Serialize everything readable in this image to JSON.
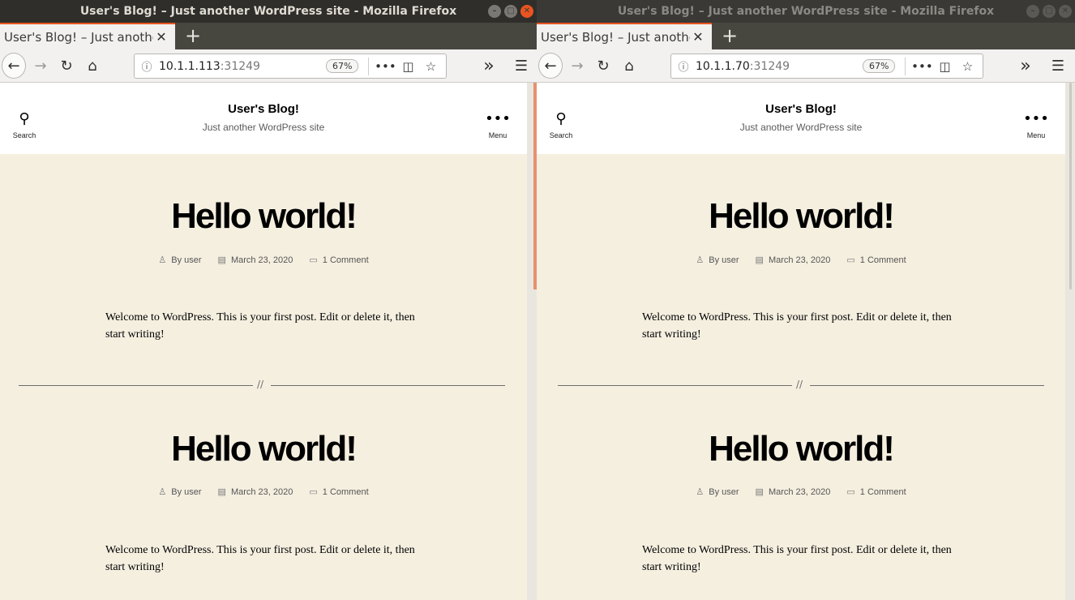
{
  "windows": [
    {
      "window_title": "User's Blog! – Just another WordPress site - Mozilla Firefox",
      "tab_title": "User's Blog! – Just another W",
      "url_host": "10.1.1.113",
      "url_port": ":31249",
      "zoom": "67%",
      "site": {
        "title": "User's Blog!",
        "description": "Just another WordPress site",
        "search_label": "Search",
        "menu_label": "Menu"
      },
      "posts": [
        {
          "title": "Hello world!",
          "author": "By user",
          "date": "March 23, 2020",
          "comments": "1 Comment",
          "body": "Welcome to WordPress. This is your first post. Edit or delete it, then start writing!"
        },
        {
          "title": "Hello world!",
          "author": "By user",
          "date": "March 23, 2020",
          "comments": "1 Comment",
          "body": "Welcome to WordPress. This is your first post. Edit or delete it, then start writing!"
        }
      ],
      "divider_symbol": "//"
    },
    {
      "window_title": "User's Blog! – Just another WordPress site - Mozilla Firefox",
      "tab_title": "User's Blog! – Just another W",
      "url_host": "10.1.1.70",
      "url_port": ":31249",
      "zoom": "67%",
      "site": {
        "title": "User's Blog!",
        "description": "Just another WordPress site",
        "search_label": "Search",
        "menu_label": "Menu"
      },
      "posts": [
        {
          "title": "Hello world!",
          "author": "By user",
          "date": "March 23, 2020",
          "comments": "1 Comment",
          "body": "Welcome to WordPress. This is your first post. Edit or delete it, then start writing!"
        },
        {
          "title": "Hello world!",
          "author": "By user",
          "date": "March 23, 2020",
          "comments": "1 Comment",
          "body": "Welcome to WordPress. This is your first post. Edit or delete it, then start writing!"
        }
      ],
      "divider_symbol": "//"
    }
  ],
  "icons": {
    "close": "close-icon",
    "minimize": "minimize-icon",
    "maximize": "maximize-icon",
    "back": "back-arrow-icon",
    "forward": "forward-arrow-icon",
    "reload": "reload-icon",
    "home": "home-icon",
    "info": "info-icon",
    "more": "more-dots-icon",
    "pocket": "pocket-icon",
    "bookmark": "star-icon",
    "overflow": "overflow-chevron-icon",
    "menu": "hamburger-icon",
    "search": "search-icon",
    "user": "user-icon",
    "calendar": "calendar-icon",
    "comment": "comment-icon"
  },
  "colors": {
    "accent": "#e95420",
    "page_bg": "#f5efe0",
    "scroll_accent": "#e8906f"
  }
}
